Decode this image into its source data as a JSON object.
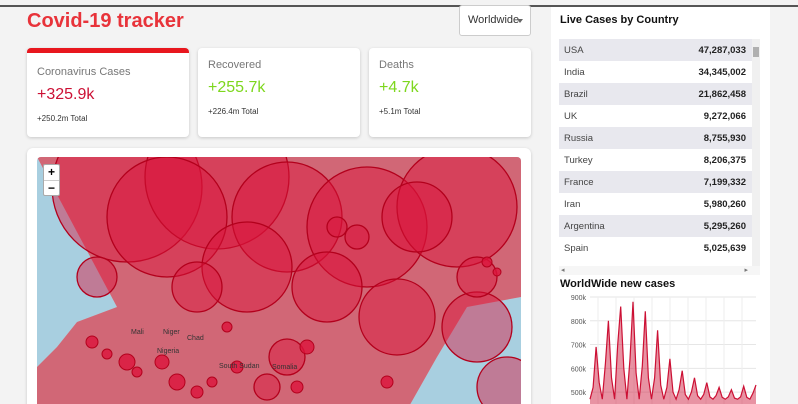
{
  "app": {
    "title": "Covid-19 tracker"
  },
  "selector": {
    "selected": "Worldwide"
  },
  "cards": [
    {
      "label": "Coronavirus Cases",
      "value": "+325.9k",
      "total": "+250.2m Total",
      "color": "#cc1034",
      "active": true
    },
    {
      "label": "Recovered",
      "value": "+255.7k",
      "total": "+226.4m Total",
      "color": "#7dd71d",
      "active": false
    },
    {
      "label": "Deaths",
      "value": "+4.7k",
      "total": "+5.1m Total",
      "color": "#7dd71d",
      "active": false
    }
  ],
  "map": {
    "zoom_in": "+",
    "zoom_out": "−",
    "labels": [
      "Mali",
      "Niger",
      "Chad",
      "Nigeria",
      "South Sudan",
      "Somalia"
    ],
    "circle_color": "#cc1034"
  },
  "sidebar": {
    "live_title": "Live Cases by Country",
    "countries": [
      {
        "name": "USA",
        "cases": "47,287,033"
      },
      {
        "name": "India",
        "cases": "34,345,002"
      },
      {
        "name": "Brazil",
        "cases": "21,862,458"
      },
      {
        "name": "UK",
        "cases": "9,272,066"
      },
      {
        "name": "Russia",
        "cases": "8,755,930"
      },
      {
        "name": "Turkey",
        "cases": "8,206,375"
      },
      {
        "name": "France",
        "cases": "7,199,332"
      },
      {
        "name": "Iran",
        "cases": "5,980,260"
      },
      {
        "name": "Argentina",
        "cases": "5,295,260"
      },
      {
        "name": "Spain",
        "cases": "5,025,639"
      }
    ],
    "chart_title": "WorldWide new cases"
  },
  "chart_data": {
    "type": "area",
    "title": "WorldWide new cases",
    "y_ticks": [
      "900k",
      "800k",
      "700k",
      "600k",
      "500k"
    ],
    "ylim": [
      450000,
      900000
    ],
    "color": "#cc1034",
    "grid": true,
    "values": [
      470000,
      520000,
      690000,
      540000,
      470000,
      620000,
      800000,
      560000,
      470000,
      700000,
      860000,
      600000,
      470000,
      640000,
      880000,
      580000,
      470000,
      610000,
      840000,
      560000,
      470000,
      560000,
      760000,
      530000,
      470000,
      520000,
      640000,
      500000,
      470000,
      510000,
      590000,
      490000,
      470000,
      500000,
      560000,
      485000,
      470000,
      490000,
      540000,
      480000,
      470000,
      485000,
      520000,
      478000,
      470000,
      480000,
      510000,
      475000,
      470000,
      480000,
      525000,
      478000,
      470000,
      495000,
      530000
    ]
  }
}
